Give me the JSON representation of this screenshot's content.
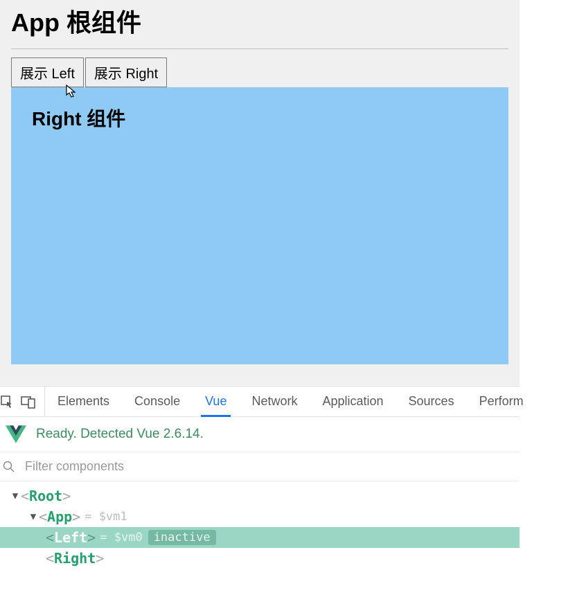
{
  "app": {
    "title": "App 根组件",
    "buttons": {
      "show_left": "展示 Left",
      "show_right": "展示 Right"
    },
    "component_title": "Right 组件"
  },
  "devtools": {
    "tabs": {
      "elements": "Elements",
      "console": "Console",
      "vue": "Vue",
      "network": "Network",
      "application": "Application",
      "sources": "Sources",
      "performance": "Perform"
    },
    "active_tab": "vue",
    "vue_status": "Ready. Detected Vue 2.6.14.",
    "filter_placeholder": "Filter components",
    "tree": {
      "root": "Root",
      "app": "App",
      "app_vm": " = $vm1",
      "left": "Left",
      "left_vm": " = $vm0",
      "left_badge": "inactive",
      "right": "Right"
    }
  }
}
